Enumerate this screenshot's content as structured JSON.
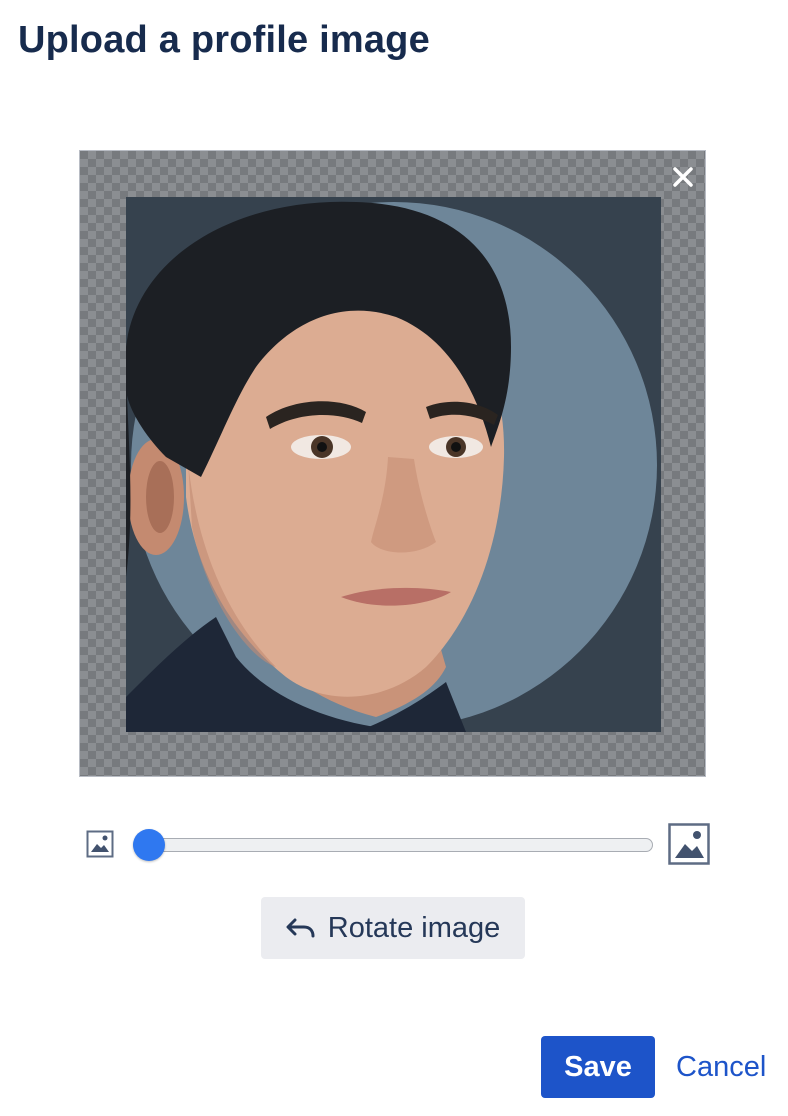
{
  "dialog": {
    "title": "Upload a profile image"
  },
  "cropper": {
    "close_icon": "close-icon",
    "background_color": "#36424e",
    "circle_color": "#6e8699",
    "checker_light": "#8b8e92",
    "checker_dark": "#777a7e"
  },
  "zoom": {
    "min_icon": "image-small-icon",
    "max_icon": "image-large-icon",
    "value_fraction": 0.0,
    "accent_color": "#2f78f0"
  },
  "actions": {
    "rotate_label": "Rotate image",
    "rotate_icon": "undo-arrow-icon",
    "save_label": "Save",
    "cancel_label": "Cancel",
    "primary_color": "#1d54c9"
  }
}
